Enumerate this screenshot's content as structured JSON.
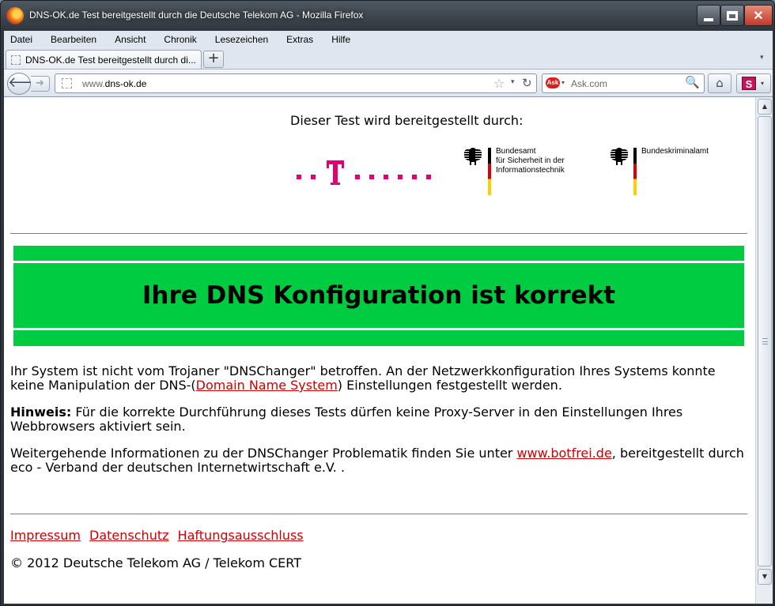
{
  "window": {
    "title": "DNS-OK.de Test bereitgestellt durch die Deutsche Telekom AG - Mozilla Firefox"
  },
  "menu": [
    "Datei",
    "Bearbeiten",
    "Ansicht",
    "Chronik",
    "Lesezeichen",
    "Extras",
    "Hilfe"
  ],
  "tab": {
    "label": "DNS-OK.de Test bereitgestellt durch di...",
    "new_tab": "+"
  },
  "nav": {
    "url_prefix": "www.",
    "url_domain": "dns-ok.de",
    "search_placeholder": "Ask.com",
    "search_engine_logo": "Ask"
  },
  "page": {
    "sponsor_label": "Dieser Test wird bereitgestellt durch:",
    "bsi_line1": "Bundesamt",
    "bsi_line2": "für Sicherheit in der",
    "bsi_line3": "Informationstechnik",
    "bka_line1": "Bundeskriminalamt",
    "banner_title": "Ihre DNS Konfiguration ist korrekt",
    "p1_before": "Ihr System ist nicht vom Trojaner \"DNSChanger\" betroffen. An der Netzwerkkonfiguration Ihres Systems konnte keine Manipulation der DNS-(",
    "p1_link": "Domain Name System",
    "p1_after": ") Einstellungen festgestellt werden.",
    "p2_bold": "Hinweis:",
    "p2_text": " Für die korrekte Durchführung dieses Tests dürfen keine Proxy-Server in den Einstellungen Ihres Webbrowsers aktiviert sein.",
    "p3_before": "Weitergehende Informationen zu der DNSChanger Problematik finden Sie unter ",
    "p3_link": "www.botfrei.de",
    "p3_after": ", bereitgestellt durch eco - Verband der deutschen Internetwirtschaft e.V. .",
    "footer_links": [
      "Impressum",
      "Datenschutz",
      "Haftungsausschluss"
    ],
    "copyright": "© 2012 Deutsche Telekom AG / Telekom CERT"
  },
  "colors": {
    "banner_green": "#00cc41",
    "link_red": "#cc0000",
    "telekom_magenta": "#e20074"
  }
}
